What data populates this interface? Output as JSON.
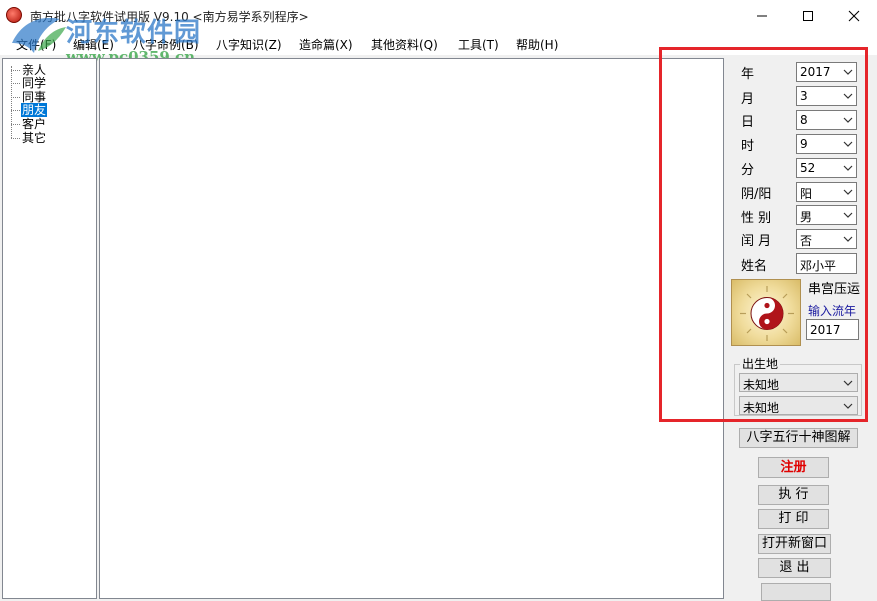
{
  "window": {
    "title": "南方批八字软件试用版 V9.10   <南方易学系列程序>"
  },
  "watermark": {
    "site_name": "河东软件园",
    "url": "www.pc0359.cn"
  },
  "menu": [
    {
      "label": "文件(F)"
    },
    {
      "label": "编辑(E)"
    },
    {
      "label": "八字命例(B)"
    },
    {
      "label": "八字知识(Z)"
    },
    {
      "label": "造命篇(X)"
    },
    {
      "label": "其他资料(Q)"
    },
    {
      "label": "工具(T)"
    },
    {
      "label": "帮助(H)"
    }
  ],
  "tree": {
    "items": [
      {
        "label": "亲人"
      },
      {
        "label": "同学"
      },
      {
        "label": "同事"
      },
      {
        "label": "朋友",
        "selected": true
      },
      {
        "label": "客户"
      },
      {
        "label": "其它"
      }
    ]
  },
  "form": {
    "fields": [
      {
        "label": "年",
        "value": "2017"
      },
      {
        "label": "月",
        "value": "3"
      },
      {
        "label": "日",
        "value": "8"
      },
      {
        "label": "时",
        "value": "9"
      },
      {
        "label": "分",
        "value": "52"
      },
      {
        "label": "阴/阳",
        "value": "阳"
      },
      {
        "label": "性 别",
        "value": "男"
      },
      {
        "label": "闰 月",
        "value": "否"
      }
    ],
    "name_label": "姓名",
    "name_value": "邓小平",
    "palace_label": "串宫压运",
    "liunian_label": "输入流年",
    "liunian_value": "2017",
    "birthplace_label": "出生地",
    "birthplace_1": "未知地",
    "birthplace_2": "未知地"
  },
  "buttons": {
    "diagram": "八字五行十神图解",
    "register": "注册",
    "execute": "执  行",
    "print": "打  印",
    "new_window": "打开新窗口",
    "exit": "退  出",
    "blank": ""
  },
  "colors": {
    "highlight": "#e5252a",
    "selection": "#0078d7",
    "register_text": "#e00000"
  }
}
